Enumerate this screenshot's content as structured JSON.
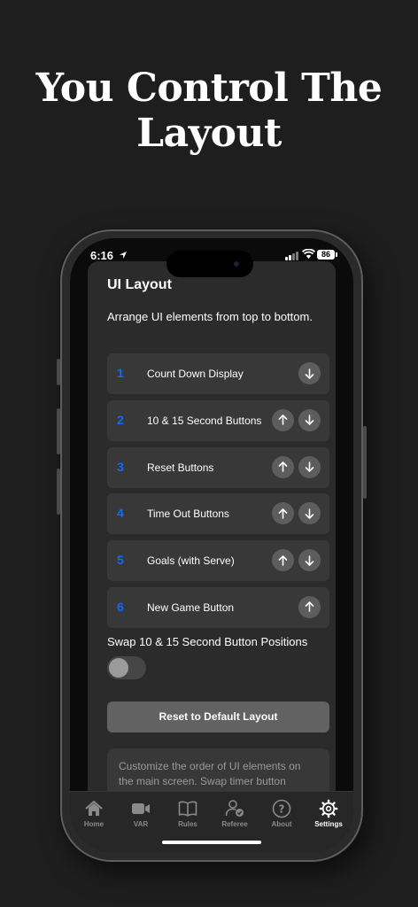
{
  "headline": {
    "line1": "You Control The",
    "line2": "Layout"
  },
  "status": {
    "time": "6:16",
    "battery": "86"
  },
  "settings": {
    "title": "UI Layout",
    "subtitle": "Arrange UI elements from top to bottom.",
    "items": [
      {
        "num": "1",
        "label": "Count Down Display"
      },
      {
        "num": "2",
        "label": "10 & 15 Second Buttons"
      },
      {
        "num": "3",
        "label": "Reset Buttons"
      },
      {
        "num": "4",
        "label": "Time Out Buttons"
      },
      {
        "num": "5",
        "label": "Goals (with Serve)"
      },
      {
        "num": "6",
        "label": "New Game Button"
      }
    ],
    "swap_label": "Swap 10 & 15 Second Button Positions",
    "swap_enabled": false,
    "reset_label": "Reset to Default Layout",
    "info_text": "Customize the order of UI elements on the main screen. Swap timer button"
  },
  "tabs": [
    {
      "label": "Home",
      "icon": "house-icon"
    },
    {
      "label": "VAR",
      "icon": "video-camera-icon"
    },
    {
      "label": "Rules",
      "icon": "book-icon"
    },
    {
      "label": "Referee",
      "icon": "referee-person-check-icon"
    },
    {
      "label": "About",
      "icon": "question-circle-icon"
    },
    {
      "label": "Settings",
      "icon": "gear-icon",
      "active": true
    }
  ],
  "colors": {
    "accent": "#0a6cff",
    "background": "#1e1e1e",
    "card": "#383838"
  }
}
